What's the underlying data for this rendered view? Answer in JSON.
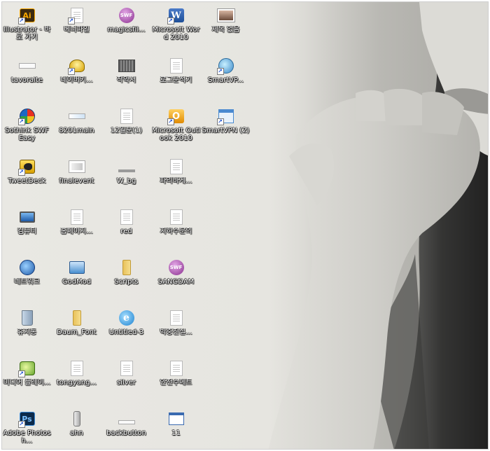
{
  "desktop": {
    "icons": [
      {
        "label": "Illustrator - 바로 가기",
        "icon": "illustrator-icon",
        "color": "#f7a700",
        "glyph": "Ai"
      },
      {
        "label": "베너파일",
        "icon": "document-icon",
        "color": "#ffffff",
        "glyph": ""
      },
      {
        "label": "magicsfil...",
        "icon": "swf-icon",
        "color": "#a24aa6",
        "glyph": "SWF"
      },
      {
        "label": "Microsoft Word 2010",
        "icon": "word-icon",
        "color": "#2a5aa8",
        "glyph": "W"
      },
      {
        "label": "제목 없음",
        "icon": "image-thumbnail-icon",
        "color": "#8a5a4a",
        "glyph": ""
      },
      {
        "label": "tavoraite",
        "icon": "file-strip-icon",
        "color": "#ffffff",
        "glyph": ""
      },
      {
        "label": "네이버키...",
        "icon": "naver-key-icon",
        "color": "#e0b000",
        "glyph": ""
      },
      {
        "label": "작약서",
        "icon": "dark-file-icon",
        "color": "#6e6e6e",
        "glyph": ""
      },
      {
        "label": "로그분석기",
        "icon": "document-icon",
        "color": "#ffffff",
        "glyph": ""
      },
      {
        "label": "SmartVP...",
        "icon": "smartvpn-icon",
        "color": "#5aa0d8",
        "glyph": ""
      },
      {
        "label": "Sothink SWF Easy",
        "icon": "sothink-icon",
        "color": "#1c68c4",
        "glyph": ""
      },
      {
        "label": "8201main",
        "icon": "file-strip-icon",
        "color": "#ffffff",
        "glyph": ""
      },
      {
        "label": "12월분(1)",
        "icon": "document-icon",
        "color": "#ffffff",
        "glyph": ""
      },
      {
        "label": "Microsoft Outlook 2010",
        "icon": "outlook-icon",
        "color": "#f0a020",
        "glyph": "O"
      },
      {
        "label": "SmartVPN (2)",
        "icon": "smartvpn-window-icon",
        "color": "#4a8ad0",
        "glyph": ""
      },
      {
        "label": "TweetDeck",
        "icon": "tweetdeck-icon",
        "color": "#e8c020",
        "glyph": ""
      },
      {
        "label": "finalevent",
        "icon": "image-file-icon",
        "color": "#ffffff",
        "glyph": ""
      },
      {
        "label": "W_bg",
        "icon": "bg-strip-icon",
        "color": "#dddddd",
        "glyph": ""
      },
      {
        "label": "파리바게...",
        "icon": "document-icon",
        "color": "#ffffff",
        "glyph": ""
      },
      {
        "label": "",
        "icon": "",
        "color": "",
        "glyph": ""
      },
      {
        "label": "컴퓨터",
        "icon": "computer-icon",
        "color": "#3a78c8",
        "glyph": ""
      },
      {
        "label": "홈페이지...",
        "icon": "document-icon",
        "color": "#ffffff",
        "glyph": ""
      },
      {
        "label": "red",
        "icon": "document-icon",
        "color": "#ffffff",
        "glyph": ""
      },
      {
        "label": "지하수문의",
        "icon": "document-icon",
        "color": "#ffffff",
        "glyph": ""
      },
      {
        "label": "",
        "icon": "",
        "color": "",
        "glyph": ""
      },
      {
        "label": "네트워크",
        "icon": "network-icon",
        "color": "#2c7ad6",
        "glyph": ""
      },
      {
        "label": "GodMod",
        "icon": "godmode-icon",
        "color": "#4a90d0",
        "glyph": ""
      },
      {
        "label": "Scripts",
        "icon": "folder-icon",
        "color": "#e9c25b",
        "glyph": ""
      },
      {
        "label": "SANGDAM",
        "icon": "swf-icon",
        "color": "#a24aa6",
        "glyph": "SWF"
      },
      {
        "label": "",
        "icon": "",
        "color": "",
        "glyph": ""
      },
      {
        "label": "휴지통",
        "icon": "recycle-bin-icon",
        "color": "#9fb4c8",
        "glyph": ""
      },
      {
        "label": "Daum_Font",
        "icon": "folder-icon",
        "color": "#e9c25b",
        "glyph": ""
      },
      {
        "label": "Untitled-3",
        "icon": "internet-explorer-icon",
        "color": "#3aa0e0",
        "glyph": "e"
      },
      {
        "label": "박중진실...",
        "icon": "document-icon",
        "color": "#ffffff",
        "glyph": ""
      },
      {
        "label": "",
        "icon": "",
        "color": "",
        "glyph": ""
      },
      {
        "label": "미디어 플레이...",
        "icon": "media-player-icon",
        "color": "#6aa830",
        "glyph": ""
      },
      {
        "label": "tongyang...",
        "icon": "document-icon",
        "color": "#ffffff",
        "glyph": ""
      },
      {
        "label": "silver",
        "icon": "document-icon",
        "color": "#ffffff",
        "glyph": ""
      },
      {
        "label": "안전수메트",
        "icon": "document-icon",
        "color": "#ffffff",
        "glyph": ""
      },
      {
        "label": "",
        "icon": "",
        "color": "",
        "glyph": ""
      },
      {
        "label": "Adobe Photosh...",
        "icon": "photoshop-icon",
        "color": "#1f5fa8",
        "glyph": "Ps"
      },
      {
        "label": "ahn",
        "icon": "ahnlab-icon",
        "color": "#cccccc",
        "glyph": ""
      },
      {
        "label": "backbutton",
        "icon": "file-strip-icon",
        "color": "#ffffff",
        "glyph": ""
      },
      {
        "label": "11",
        "icon": "window-file-icon",
        "color": "#3a6ab0",
        "glyph": ""
      },
      {
        "label": "",
        "icon": "",
        "color": "",
        "glyph": ""
      }
    ]
  }
}
